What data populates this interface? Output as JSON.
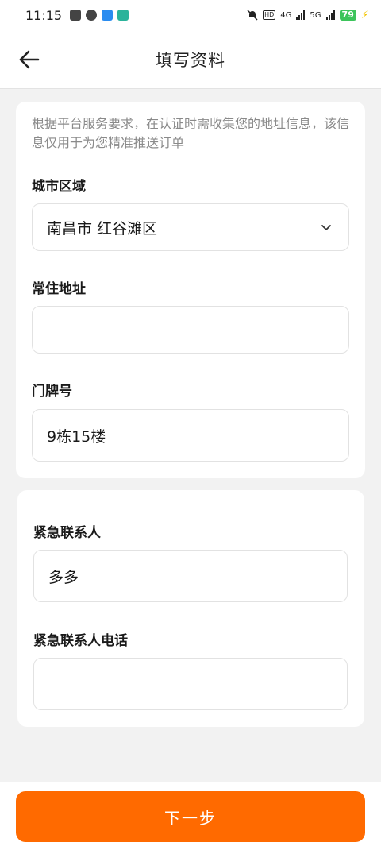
{
  "status_bar": {
    "time": "11:15",
    "network_1": "4G",
    "network_2": "5G",
    "hd_label": "HD",
    "battery": "79"
  },
  "nav": {
    "title": "填写资料"
  },
  "address_section": {
    "notice": "根据平台服务要求，在认证时需收集您的地址信息，该信息仅用于为您精准推送订单",
    "city_label": "城市区域",
    "city_value": "南昌市 红谷滩区",
    "address_label": "常住地址",
    "address_value": "",
    "door_label": "门牌号",
    "door_value": "9栋15楼"
  },
  "contact_section": {
    "contact_label": "紧急联系人",
    "contact_value": "多多",
    "phone_label": "紧急联系人电话",
    "phone_value": ""
  },
  "footer": {
    "next_label": "下一步"
  },
  "colors": {
    "accent": "#ff6a00",
    "background": "#f2f2f2",
    "card": "#ffffff"
  }
}
